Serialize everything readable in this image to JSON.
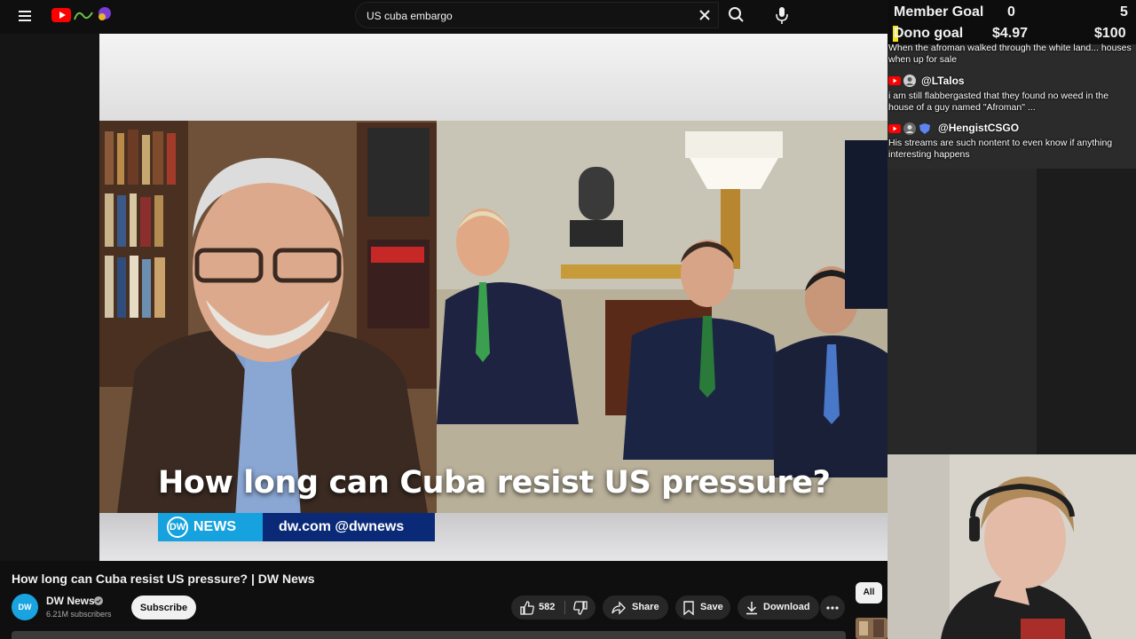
{
  "search": {
    "query": "US cuba embargo"
  },
  "video": {
    "headline": "How long can Cuba resist US pressure?",
    "lower_third": {
      "badge": "NEWS",
      "badge_logo": "DW",
      "url": "dw.com @dwnews"
    },
    "title": "How long can Cuba resist US pressure? | DW News"
  },
  "channel": {
    "avatar": "DW",
    "name": "DW News",
    "subscribers": "6.21M subscribers",
    "subscribe_label": "Subscribe"
  },
  "actions": {
    "likes": "582",
    "share_label": "Share",
    "save_label": "Save",
    "download_label": "Download"
  },
  "chips": {
    "all": "All"
  },
  "overlay": {
    "member_goal": {
      "label": "Member Goal",
      "current": "0",
      "target": "5"
    },
    "dono_goal": {
      "label": "Dono goal",
      "current": "$4.97",
      "target": "$100"
    },
    "chat": [
      {
        "user": "",
        "text": "When the afroman walked through the white land... houses when up for sale"
      },
      {
        "user": "@LTalos",
        "text": "i am still flabbergasted that they found no weed in the house of a guy named \"Afroman\" ..."
      },
      {
        "user": "@HengistCSGO",
        "text": "His streams are such nontent to even know if anything interesting happens"
      }
    ]
  },
  "colors": {
    "youtube_red": "#ff0000",
    "dw_blue": "#16a2de",
    "dw_navy": "#0a2a78",
    "dono_yellow": "#f3e51a"
  },
  "icons": [
    "menu-icon",
    "youtube-logo-icon",
    "clear-icon",
    "search-icon",
    "mic-icon",
    "verified-icon",
    "like-icon",
    "dislike-icon",
    "share-icon",
    "save-icon",
    "download-icon",
    "more-icon"
  ]
}
